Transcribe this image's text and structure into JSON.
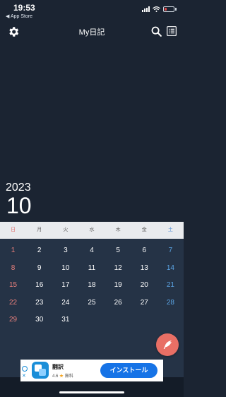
{
  "status_bar": {
    "time": "19:53",
    "back_label": "◀ App Store"
  },
  "header": {
    "title": "My日記"
  },
  "calendar": {
    "year": "2023",
    "month": "10",
    "weekdays": [
      "日",
      "月",
      "火",
      "水",
      "木",
      "金",
      "土"
    ],
    "weeks": [
      [
        "1",
        "2",
        "3",
        "4",
        "5",
        "6",
        "7"
      ],
      [
        "8",
        "9",
        "10",
        "11",
        "12",
        "13",
        "14"
      ],
      [
        "15",
        "16",
        "17",
        "18",
        "19",
        "20",
        "21"
      ],
      [
        "22",
        "23",
        "24",
        "25",
        "26",
        "27",
        "28"
      ],
      [
        "29",
        "30",
        "31",
        "",
        "",
        "",
        ""
      ]
    ]
  },
  "ad": {
    "app_name": "翻訳",
    "rating": "4.6",
    "price": "無料",
    "install_label": "インストール"
  },
  "colors": {
    "background": "#1b2432",
    "calendar_bg": "#253346",
    "sunday": "#e9807c",
    "saturday": "#5ba4e4",
    "fab": "#e86f65",
    "install": "#1673e6"
  },
  "icons": [
    "gear-icon",
    "search-icon",
    "list-icon",
    "feather-pen-icon",
    "wifi-icon",
    "signal-icon",
    "battery-icon",
    "translate-app-icon",
    "ad-choices-icon"
  ]
}
